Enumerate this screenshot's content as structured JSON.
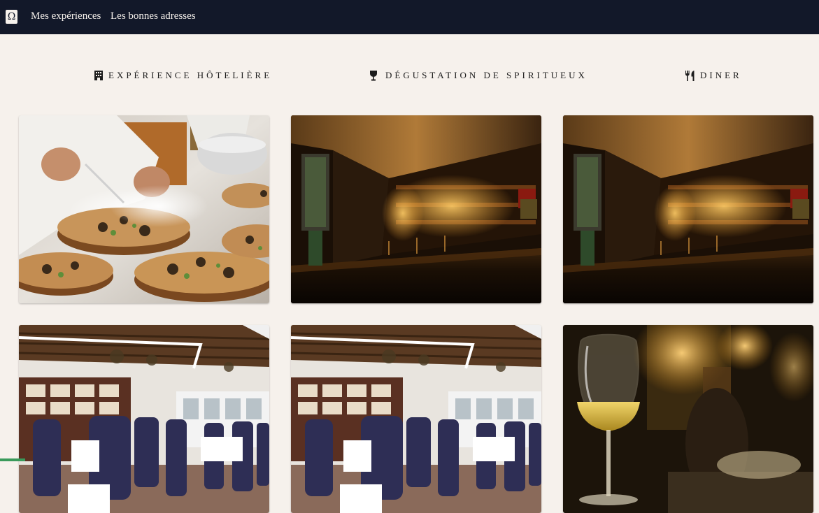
{
  "nav": {
    "logo_glyph": "Ω",
    "links": [
      "Mes expériences",
      "Les bonnes adresses"
    ]
  },
  "categories": [
    {
      "label": "EXPÉRIENCE HÔTELIÈRE",
      "icon": "hotel-icon"
    },
    {
      "label": "DÉGUSTATION DE SPIRITUEUX",
      "icon": "wine-glass-icon"
    },
    {
      "label": "DINER",
      "icon": "utensils-icon"
    }
  ],
  "cards": [
    {
      "image": "chef-plating-dish"
    },
    {
      "image": "bar-interior"
    },
    {
      "image": "bar-interior"
    },
    {
      "image": "restaurant-dining-room"
    },
    {
      "image": "restaurant-dining-room"
    },
    {
      "image": "wine-glass"
    }
  ],
  "colors": {
    "navbar": "#121829",
    "background": "#f6f1ec",
    "text": "#1c1c1c"
  }
}
